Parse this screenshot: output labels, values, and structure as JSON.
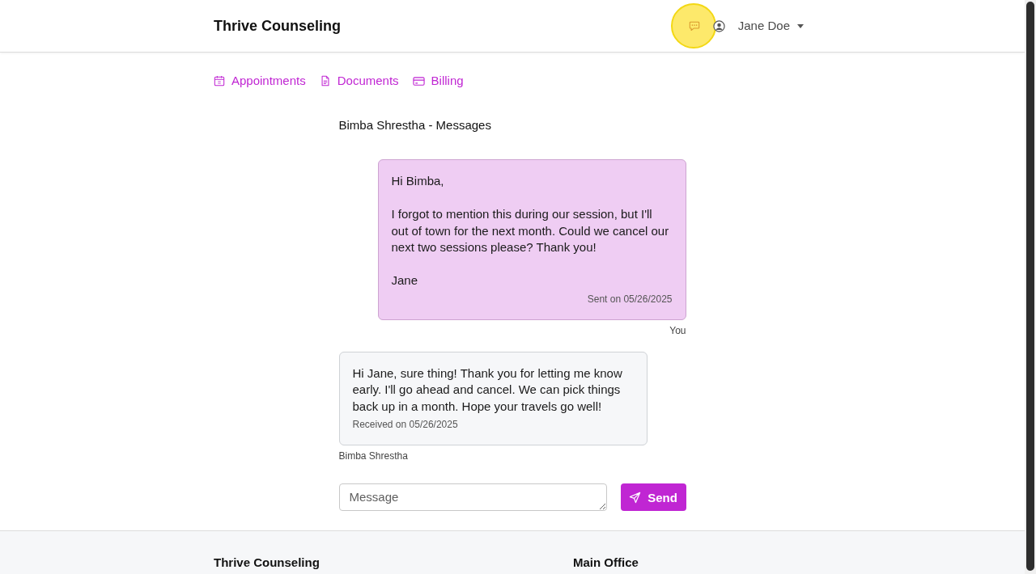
{
  "header": {
    "brand": "Thrive Counseling",
    "user_name": "Jane Doe"
  },
  "nav": [
    {
      "kind": "appointments",
      "label": "Appointments"
    },
    {
      "kind": "documents",
      "label": "Documents"
    },
    {
      "kind": "billing",
      "label": "Billing"
    }
  ],
  "thread": {
    "title": "Bimba Shrestha - Messages",
    "messages": [
      {
        "kind": "sent",
        "text": "Hi Bimba,\n\nI forgot to mention this during our session, but I'll out of town for the next month. Could we cancel our next two sessions please? Thank you!\n\nJane",
        "timestamp": "Sent on 05/26/2025",
        "author": "You"
      },
      {
        "kind": "received",
        "text": "Hi Jane, sure thing! Thank you for letting me know early. I'll go ahead and cancel. We can pick things back up in a month. Hope your travels go well!",
        "timestamp": "Received on 05/26/2025",
        "author": "Bimba Shrestha"
      }
    ]
  },
  "composer": {
    "placeholder": "Message",
    "button": "Send"
  },
  "footer": {
    "columns": [
      {
        "heading": "Thrive Counseling"
      },
      {
        "heading": "Main Office"
      }
    ]
  }
}
